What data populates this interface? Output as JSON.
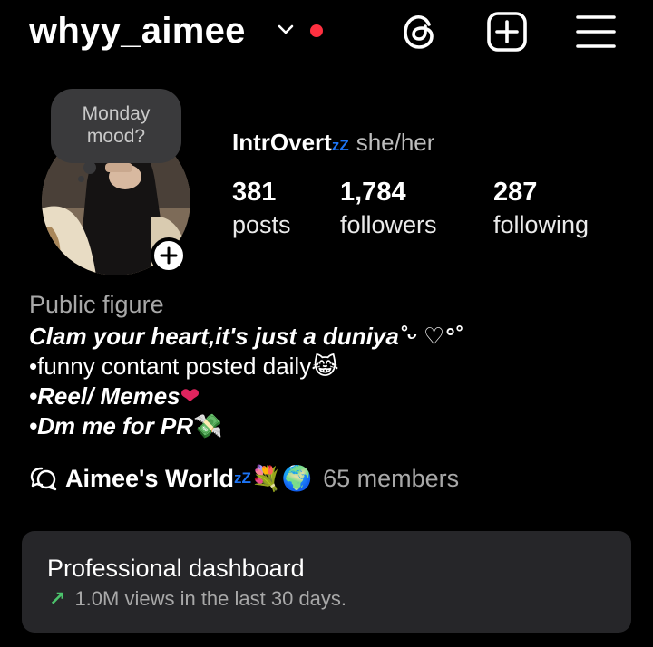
{
  "header": {
    "username": "whyy_aimee",
    "icons": [
      "chevron-down-icon",
      "notification-dot",
      "threads-icon",
      "create-post-icon",
      "menu-icon"
    ]
  },
  "note": {
    "line1": "Monday",
    "line2": "mood?"
  },
  "profile": {
    "display_name": "IntrOvert",
    "sleep_mark": "zZ",
    "pronouns": "she/her",
    "stats": [
      {
        "value": "381",
        "label": "posts"
      },
      {
        "value": "1,784",
        "label": "followers"
      },
      {
        "value": "287",
        "label": "following"
      }
    ]
  },
  "bio": {
    "category": "Public figure",
    "lines": [
      "Clam your heart,it's just a duniya˚ᵕ ♡°˚",
      "•funny contant posted daily",
      "•Reel/ Memes",
      "•Dm me for PR"
    ],
    "line_emojis": [
      "",
      "😹",
      "❤",
      "💸"
    ]
  },
  "channel": {
    "name": "Aimee's World",
    "sleep_mark": "zZ",
    "emojis": "💐🌍",
    "members": "65 members"
  },
  "dashboard": {
    "title": "Professional dashboard",
    "arrow": "↗",
    "subtitle": "1.0M views in the last 30 days."
  },
  "colors": {
    "background": "#000000",
    "accent_red": "#ff3040",
    "accent_green": "#4cc36c",
    "zz_blue": "#1d74f5",
    "card": "#262629"
  }
}
